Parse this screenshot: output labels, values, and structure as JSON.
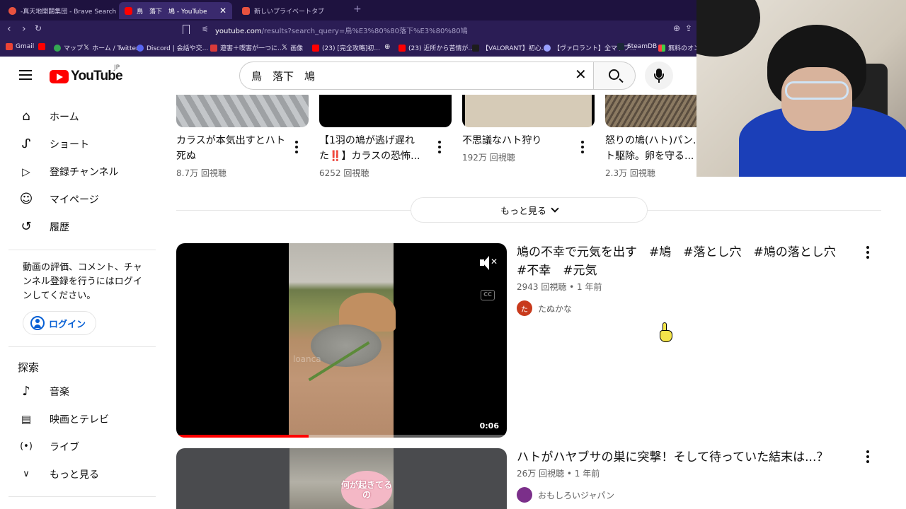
{
  "browser": {
    "tabs": [
      {
        "title": "-真天地開闢集団 - Brave Search",
        "active": false
      },
      {
        "title": "鳥　落下　鳩 - YouTube",
        "active": true
      },
      {
        "title": "新しいプライベートタブ",
        "active": false
      }
    ],
    "url_host": "youtube.com",
    "url_rest": "/results?search_query=鳥%E3%80%80落下%E3%80%80鳩",
    "bookmarks": [
      "Gmail",
      "",
      "マップ",
      "ホーム / Twitter",
      "Discord | 会話や交...",
      "遊害＋喫害が一つに...",
      "画像",
      "(23) [完全攻略]初...",
      "",
      "(23) 近所から苦情が...",
      "【VALORANT】初心...",
      "【ヴァロラント】全マップ...",
      "SteamDB",
      "無料のオンラ"
    ]
  },
  "header": {
    "logo_text": "YouTube",
    "region": "JP",
    "search_query": "鳥　落下　鳩"
  },
  "sidebar": {
    "items": [
      {
        "label": "ホーム",
        "icon": "home-icon"
      },
      {
        "label": "ショート",
        "icon": "shorts-icon"
      },
      {
        "label": "登録チャンネル",
        "icon": "subscriptions-icon"
      },
      {
        "label": "マイページ",
        "icon": "account-icon"
      },
      {
        "label": "履歴",
        "icon": "history-icon"
      }
    ],
    "signin_prompt": "動画の評価、コメント、チャンネル登録を行うにはログインしてください。",
    "login_label": "ログイン",
    "explore_title": "探索",
    "explore_items": [
      {
        "label": "音楽",
        "icon": "music-icon"
      },
      {
        "label": "映画とテレビ",
        "icon": "movie-icon"
      },
      {
        "label": "ライブ",
        "icon": "live-icon"
      },
      {
        "label": "もっと見る",
        "icon": "chevron-down-icon"
      }
    ]
  },
  "shelf": {
    "items": [
      {
        "title": "カラスが本気出すとハト死ぬ",
        "meta": "8.7万 回視聴"
      },
      {
        "title": "【1羽の鳩が逃げ遅れた‼️】カラスの恐怖...",
        "meta": "6252 回視聴"
      },
      {
        "title": "不思議なハト狩り",
        "meta": "192万 回視聴"
      },
      {
        "title": "怒りの鳩(ハト)パン...ハト駆除。卵を守る...",
        "meta": "2.3万 回視聴"
      }
    ],
    "more_label": "もっと見る"
  },
  "results": [
    {
      "title": "鳩の不幸で元気を出す　#鳩　#落とし穴　#鳩の落とし穴　#不幸　#元気",
      "meta": "2943 回視聴 • 1 年前",
      "channel": "たぬかな",
      "channel_initial": "た",
      "duration": "0:06",
      "watermark": "loanca",
      "progress": 0.4
    },
    {
      "title": "ハトがハヤブサの巣に突撃！そして待っていた結末は...？",
      "meta": "26万 回視聴 • 1 年前",
      "channel": "おもしろいジャパン",
      "overlay_text": "何が起きてるの"
    }
  ],
  "colors": {
    "brand_red": "#ff0000",
    "link_blue": "#065fd4",
    "browser_chrome": "#2b1d55"
  }
}
